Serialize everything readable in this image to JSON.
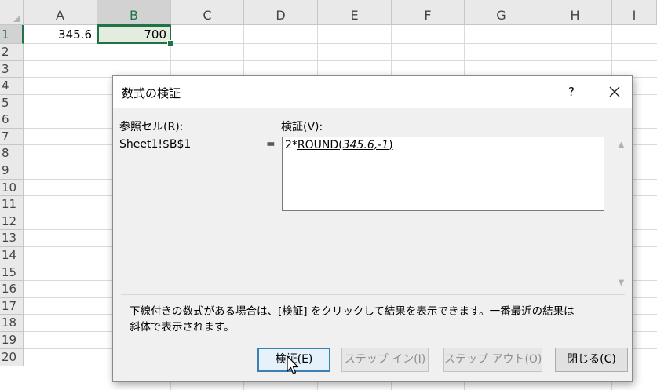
{
  "sheet": {
    "columns": [
      "A",
      "B",
      "C",
      "D",
      "E",
      "F",
      "G",
      "H",
      "I"
    ],
    "rows": [
      "1",
      "2",
      "3",
      "4",
      "5",
      "6",
      "7",
      "8",
      "9",
      "10",
      "11",
      "12",
      "13",
      "14",
      "15",
      "16",
      "17",
      "18",
      "19",
      "20"
    ],
    "cells": {
      "A1": "345.6",
      "B1": "700"
    },
    "selected_cell": "B1",
    "accent_color": "#217346"
  },
  "dialog": {
    "title": "数式の検証",
    "help_label": "?",
    "reference_label": "参照セル(R):",
    "reference_value": "Sheet1!$B$1",
    "equals": "=",
    "evaluation_label": "検証(V):",
    "formula": {
      "prefix": "2*",
      "func": "ROUND",
      "open": "(",
      "arg": "345.6,-1",
      "close": ")"
    },
    "info_line1": "下線付きの数式がある場合は、[検証] をクリックして結果を表示できます。一番最近の結果は",
    "info_line2": "斜体で表示されます。",
    "buttons": {
      "evaluate": "検証(E)",
      "step_in": "ステップ イン(I)",
      "step_out": "ステップ アウト(O)",
      "close": "閉じる(C)"
    }
  }
}
